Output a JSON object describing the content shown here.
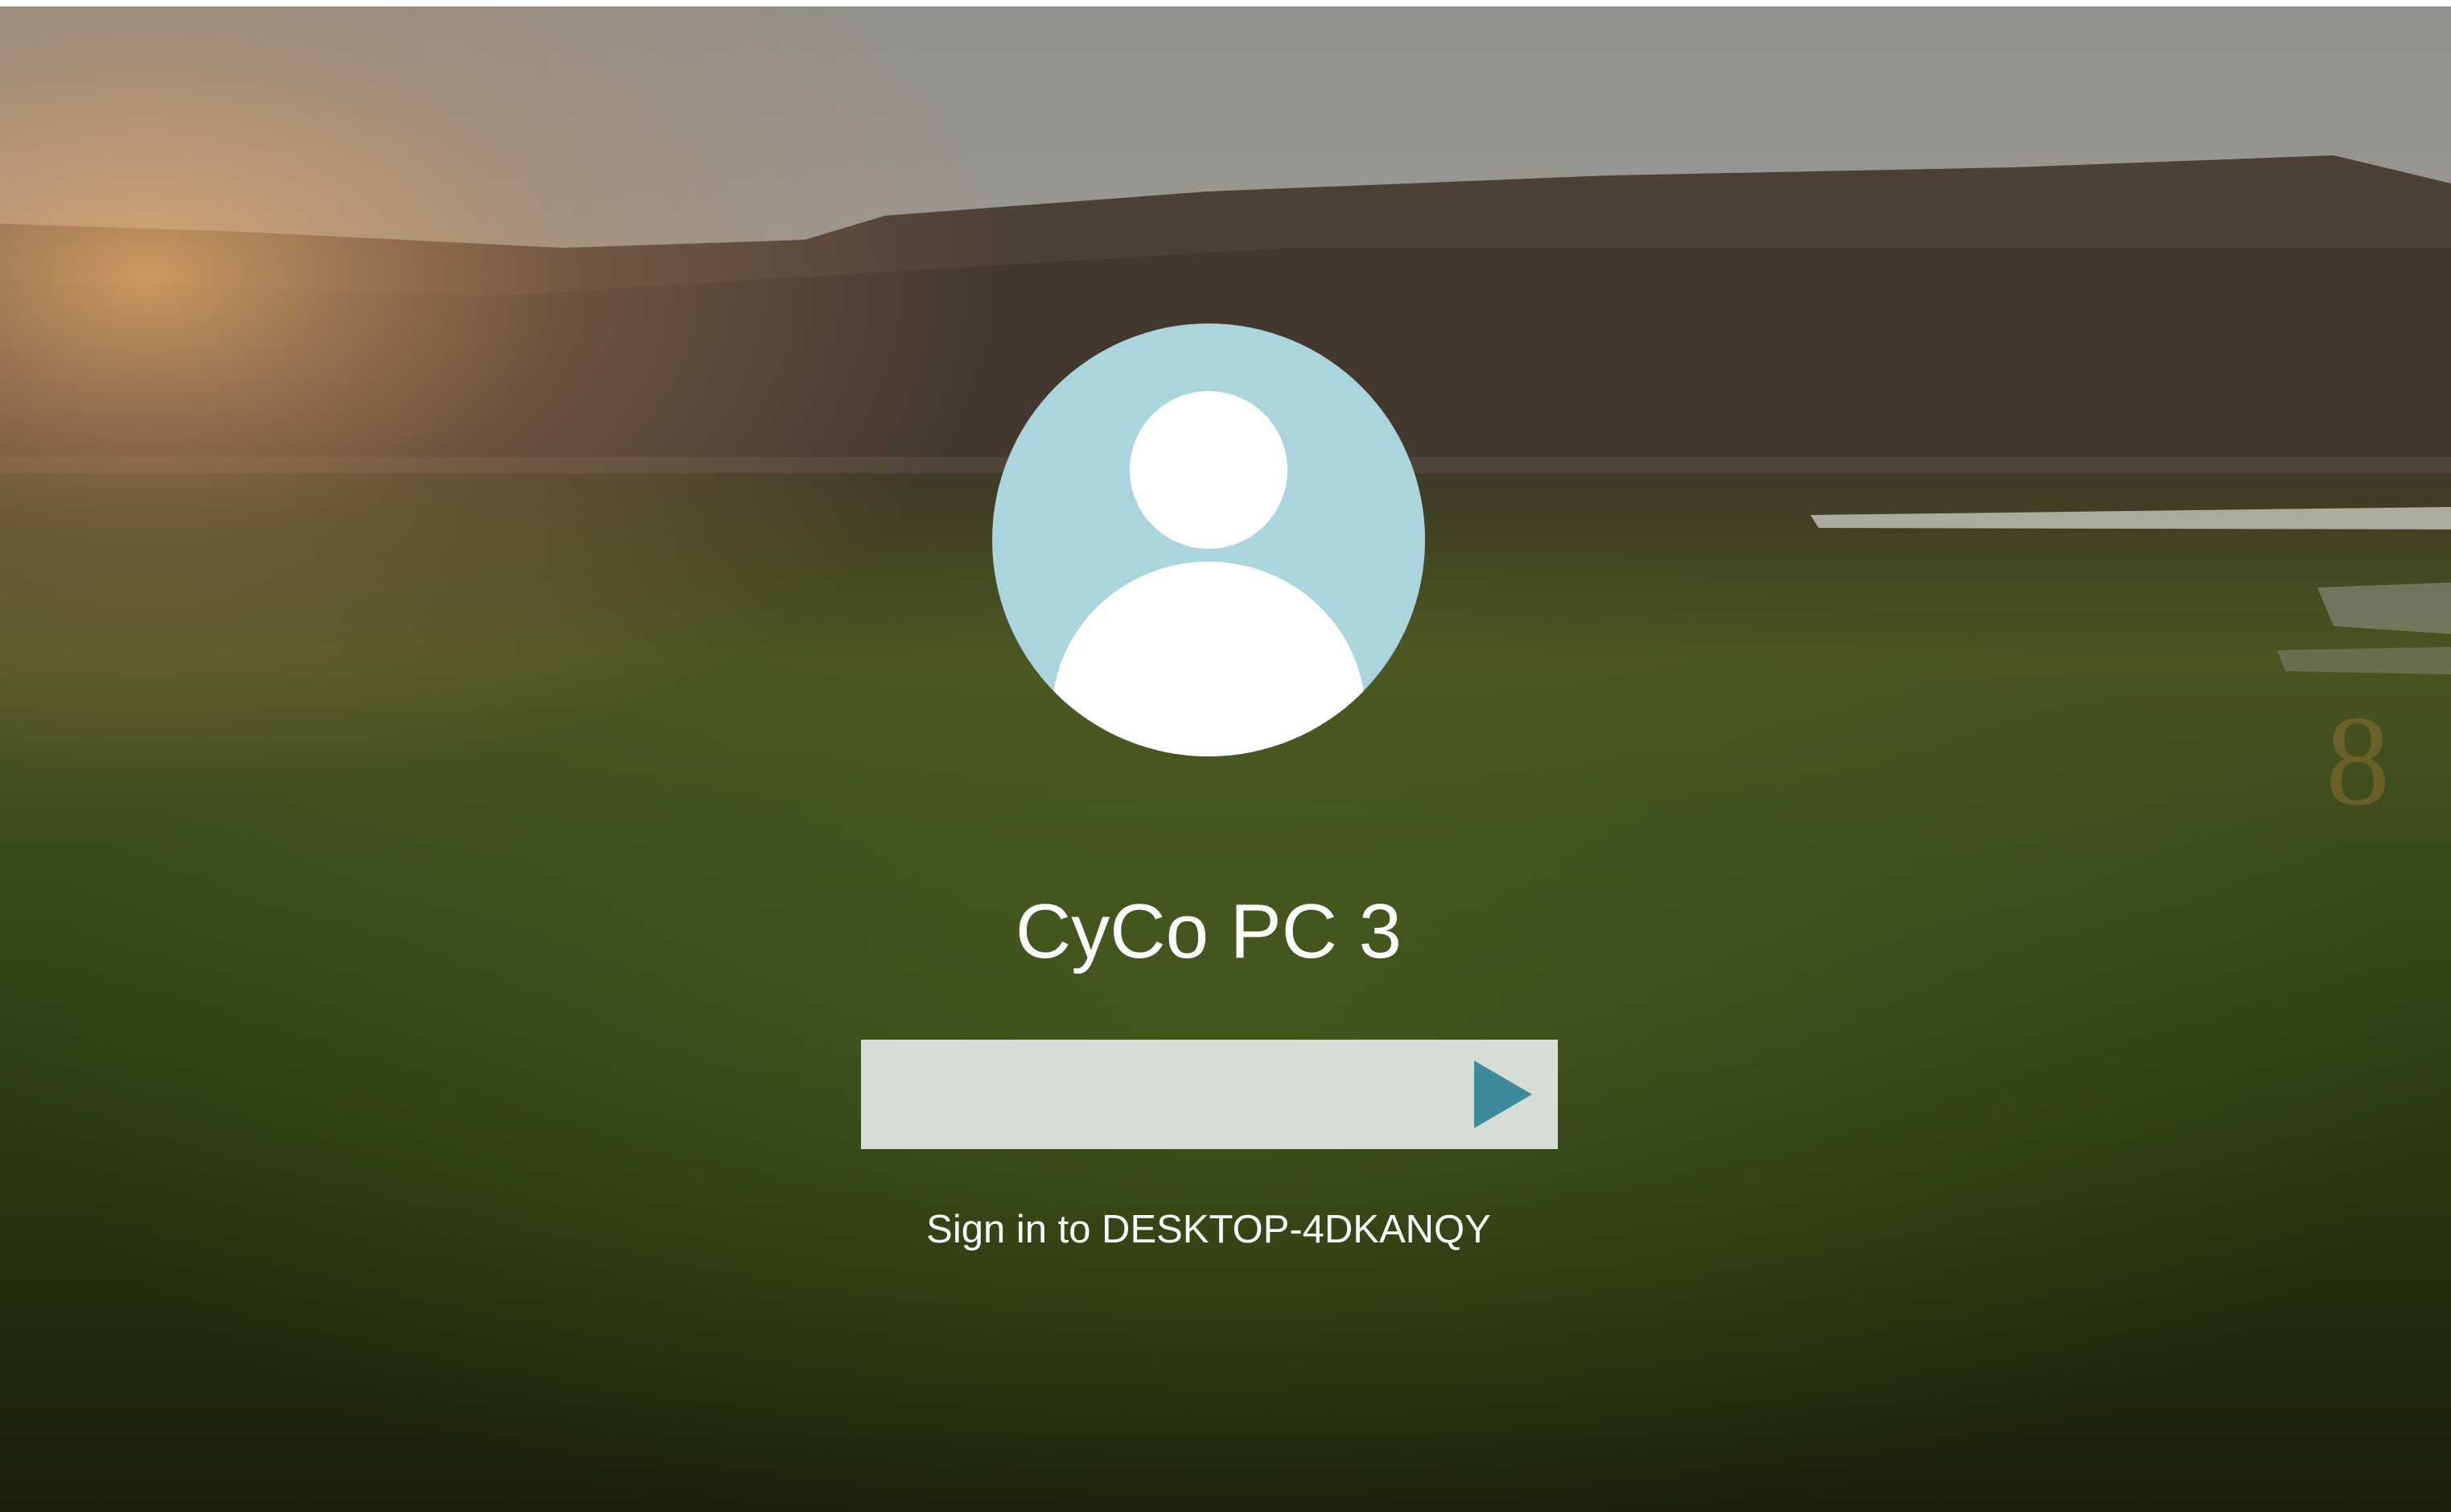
{
  "lock_screen": {
    "wallpaper": "grass-field-sunset",
    "user": {
      "display_name": "CyCo PC 3",
      "avatar_icon": "user-silhouette-icon"
    },
    "password": {
      "value": "",
      "placeholder": "",
      "submit_icon": "arrow-right-icon"
    },
    "signin_label": "Sign in to DESKTOP-4DKANQY"
  },
  "colors": {
    "avatar_background": "#aad5dc",
    "avatar_silhouette": "#ffffff",
    "submit_arrow": "#3c8a9b",
    "text": "#ffffff"
  }
}
